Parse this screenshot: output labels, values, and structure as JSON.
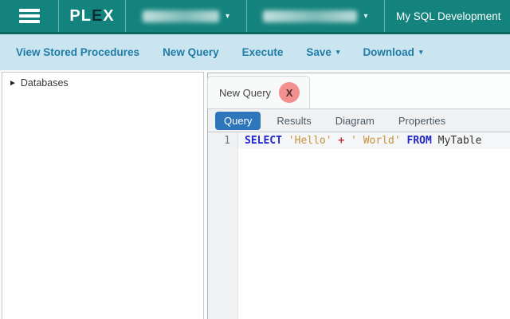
{
  "colors": {
    "header_teal": "#15837d",
    "header_border": "#0b695d",
    "toolbar_bg": "#cbe5f0",
    "toolbar_link": "#1f7ca6",
    "tab_close_bg": "#f29090",
    "subtab_active_bg": "#2e76bb",
    "code_keyword": "#2025cc",
    "code_string": "#c9913d",
    "code_operator": "#cc2f3e"
  },
  "header": {
    "brand": {
      "pl": "PL",
      "e": "E",
      "x": "X"
    },
    "dropdown_caret": "▾",
    "redacted_dropdowns": [
      {
        "redacted": true
      },
      {
        "redacted": true
      }
    ],
    "title": "My SQL Development"
  },
  "toolbar": {
    "items": [
      {
        "label": "View Stored Procedures"
      },
      {
        "label": "New Query"
      },
      {
        "label": "Execute"
      },
      {
        "label": "Save",
        "caret": "▾"
      },
      {
        "label": "Download",
        "caret": "▾"
      }
    ]
  },
  "sidebar": {
    "tree": [
      {
        "arrow": "►",
        "label": "Databases",
        "expanded": false
      }
    ]
  },
  "main": {
    "document_tab": {
      "label": "New Query",
      "close_label": "X"
    },
    "subtabs": [
      {
        "label": "Query",
        "active": true
      },
      {
        "label": "Results",
        "active": false
      },
      {
        "label": "Diagram",
        "active": false
      },
      {
        "label": "Properties",
        "active": false
      }
    ],
    "editor": {
      "lines": [
        {
          "number": "1",
          "tokens": [
            {
              "text": "SELECT",
              "type": "keyword"
            },
            {
              "text": " ",
              "type": "plain"
            },
            {
              "text": "'Hello'",
              "type": "string"
            },
            {
              "text": " ",
              "type": "plain"
            },
            {
              "text": "+",
              "type": "operator"
            },
            {
              "text": " ",
              "type": "plain"
            },
            {
              "text": "' World'",
              "type": "string"
            },
            {
              "text": " ",
              "type": "plain"
            },
            {
              "text": "FROM",
              "type": "keyword"
            },
            {
              "text": " ",
              "type": "plain"
            },
            {
              "text": "MyTable",
              "type": "identifier"
            }
          ]
        }
      ]
    }
  }
}
